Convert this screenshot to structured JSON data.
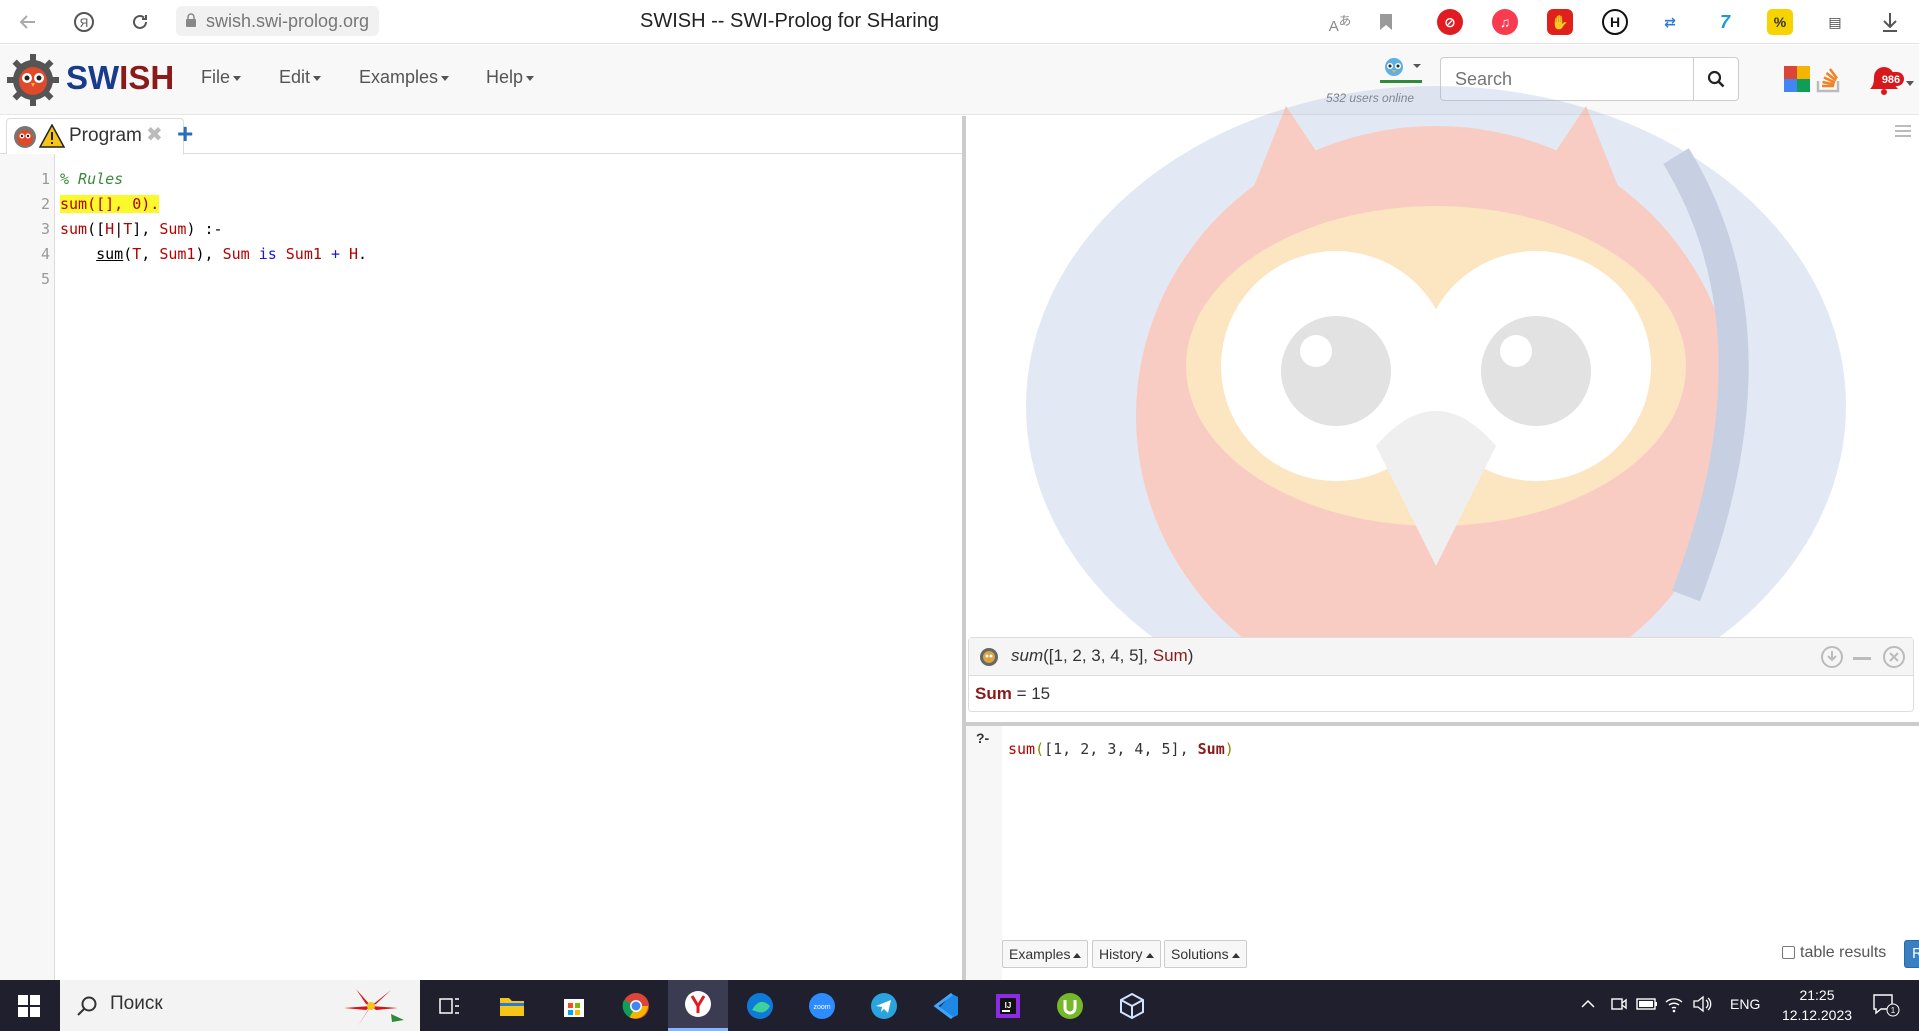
{
  "browser": {
    "url": "swish.swi-prolog.org",
    "title": "SWISH -- SWI-Prolog for SHaring"
  },
  "navbar": {
    "logo": "SWISH",
    "menus": [
      "File",
      "Edit",
      "Examples",
      "Help"
    ],
    "users_online": "532 users online",
    "search_placeholder": "Search",
    "notification_count": "986"
  },
  "editor": {
    "tab_label": "Program",
    "line_numbers": [
      "1",
      "2",
      "3",
      "4",
      "5"
    ],
    "lines": [
      "% Rules",
      "sum([], 0).",
      "sum([H|T], Sum) :-",
      "    sum(T, Sum1), Sum is Sum1 + H.",
      ""
    ]
  },
  "answer": {
    "query": "sum([1, 2, 3, 4, 5], Sum)",
    "result_var": "Sum",
    "result_eq": " = ",
    "result_value": "15"
  },
  "query_editor": {
    "prompt": "?-",
    "query": "sum([1, 2, 3, 4, 5], Sum)"
  },
  "bottom": {
    "examples_label": "Examples",
    "history_label": "History",
    "solutions_label": "Solutions",
    "table_results_label": "table results",
    "run_label": "Run!"
  },
  "taskbar": {
    "search_text": "Поиск",
    "lang": "ENG",
    "time": "21:25",
    "date": "12.12.2023",
    "notif_count": "1"
  }
}
